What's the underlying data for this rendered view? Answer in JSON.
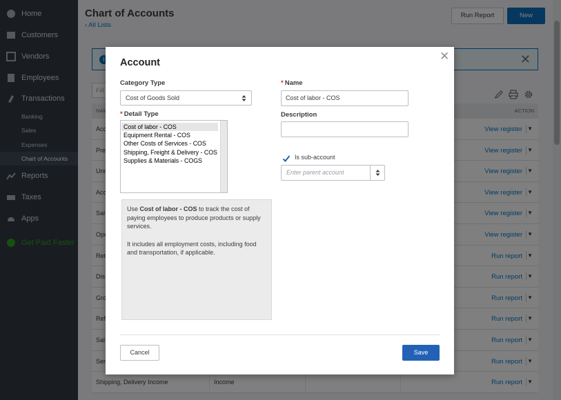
{
  "sidebar": {
    "items": [
      {
        "label": "Home",
        "icon": "home-icon"
      },
      {
        "label": "Customers",
        "icon": "customers-icon"
      },
      {
        "label": "Vendors",
        "icon": "vendors-icon"
      },
      {
        "label": "Employees",
        "icon": "employees-icon"
      },
      {
        "label": "Transactions",
        "icon": "transactions-icon"
      }
    ],
    "sub_items": [
      "Banking",
      "Sales",
      "Expenses",
      "Chart of Accounts"
    ],
    "active_sub_item": "Chart of Accounts",
    "lower_items": [
      {
        "label": "Reports",
        "icon": "reports-icon"
      },
      {
        "label": "Taxes",
        "icon": "taxes-icon"
      },
      {
        "label": "Apps",
        "icon": "apps-icon"
      }
    ],
    "cta": {
      "label": "Get Paid Faster",
      "icon": "get-paid-icon"
    }
  },
  "page": {
    "title": "Chart of Accounts",
    "back_link": "All Lists",
    "run_report": "Run Report",
    "new_button": "New",
    "filter_placeholder": "Filt",
    "table": {
      "col_name": "NAM",
      "col_action": "ACTION",
      "rows": [
        {
          "name": "Acc",
          "type": "",
          "action": "View register"
        },
        {
          "name": "Pre",
          "type": "",
          "action": "View register"
        },
        {
          "name": "Unc",
          "type": "",
          "action": "View register"
        },
        {
          "name": "Acc",
          "type": "",
          "action": "View register"
        },
        {
          "name": "Sal",
          "type": "",
          "action": "View register"
        },
        {
          "name": "Ope",
          "type": "",
          "action": "View register"
        },
        {
          "name": "Ret",
          "type": "",
          "action": "Run report"
        },
        {
          "name": "Dis",
          "type": "",
          "action": "Run report"
        },
        {
          "name": "Gro",
          "type": "",
          "action": "Run report"
        },
        {
          "name": "Ref",
          "type": "",
          "action": "Run report"
        },
        {
          "name": "Sal",
          "type": "",
          "action": "Run report"
        },
        {
          "name": "Ser",
          "type": "",
          "action": "Run report"
        },
        {
          "name": "Shipping, Delivery Income",
          "type": "Income",
          "action": "Run report"
        }
      ]
    }
  },
  "modal": {
    "title": "Account",
    "category_type": {
      "label": "Category Type",
      "value": "Cost of Goods Sold"
    },
    "detail_type": {
      "label": "Detail Type",
      "options": [
        "Cost of labor - COS",
        "Equipment Rental - COS",
        "Other Costs of Services - COS",
        "Shipping, Freight & Delivery - COS",
        "Supplies & Materials - COGS"
      ],
      "selected": "Cost of labor - COS"
    },
    "description_text": {
      "prefix": "Use ",
      "bold": "Cost of labor - COS",
      "suffix": " to track the cost of paying employees to produce products or supply services.",
      "second": "It includes all employment costs, including food and transportation, if applicable."
    },
    "name": {
      "label": "Name",
      "value": "Cost of labor - COS"
    },
    "description": {
      "label": "Description",
      "value": ""
    },
    "sub_account": {
      "label": "Is sub-account",
      "checked": true
    },
    "parent_account": {
      "placeholder": "Enter parent account"
    },
    "cancel": "Cancel",
    "save": "Save"
  },
  "colors": {
    "sidebar_bg": "#323a45",
    "primary_blue": "#2361b7",
    "link_blue": "#0077c5",
    "required_red": "#d52b1e",
    "cta_green": "#2ca01c"
  }
}
